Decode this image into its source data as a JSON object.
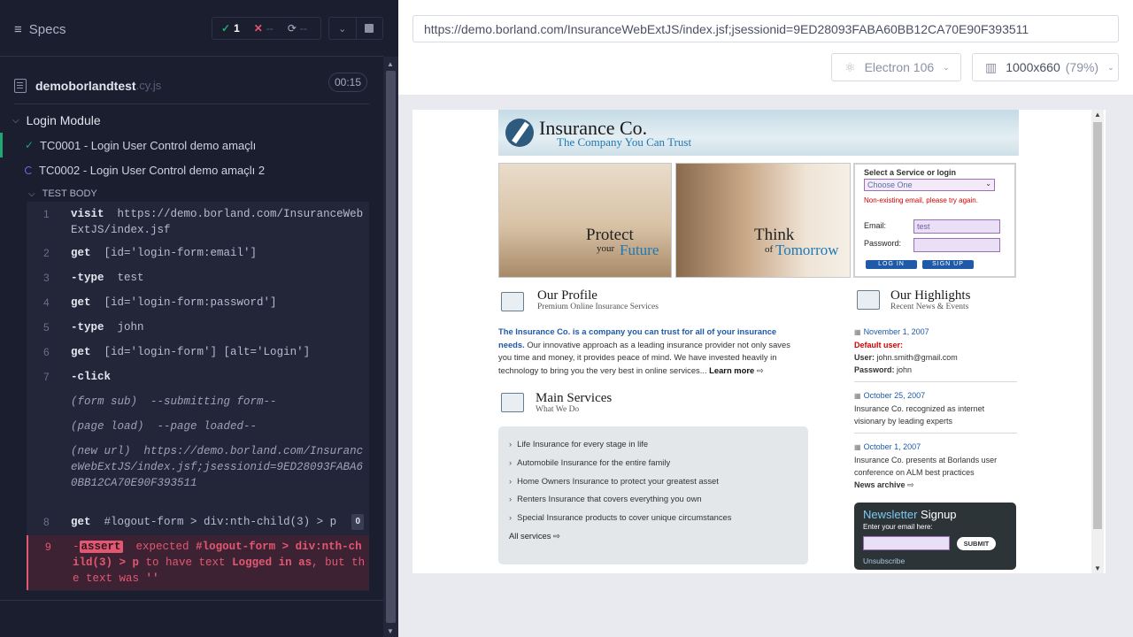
{
  "reporter": {
    "specs_label": "Specs",
    "passed": "1",
    "failed": "--",
    "pending": "--",
    "spec_name": "demoborlandtest",
    "spec_ext": ".cy.js",
    "duration": "00:15",
    "suite_title": "Login Module",
    "tests": [
      {
        "title": "TC0001 - Login User Control demo amaçlı",
        "state": "passed"
      },
      {
        "title": "TC0002 - Login User Control demo amaçlı 2",
        "state": "running"
      }
    ],
    "test_body_label": "TEST BODY",
    "commands": [
      {
        "num": "1",
        "name": "visit",
        "msg": "https://demo.borland.com/InsuranceWebExtJS/index.jsf"
      },
      {
        "num": "2",
        "name": "get",
        "msg": "[id='login-form:email']"
      },
      {
        "num": "3",
        "name": "-type",
        "msg": "test"
      },
      {
        "num": "4",
        "name": "get",
        "msg": "[id='login-form:password']"
      },
      {
        "num": "5",
        "name": "-type",
        "msg": "john"
      },
      {
        "num": "6",
        "name": "get",
        "msg": "[id='login-form'] [alt='Login']"
      },
      {
        "num": "7",
        "name": "-click",
        "msg": ""
      },
      {
        "num": "",
        "name": "(form sub)",
        "msg": "--submitting form--"
      },
      {
        "num": "",
        "name": "(page load)",
        "msg": "--page loaded--"
      },
      {
        "num": "",
        "name": "(new url)",
        "msg": "https://demo.borland.com/InsuranceWebExtJS/index.jsf;jsessionid=9ED28093FABA60BB12CA70E90F393511"
      },
      {
        "num": "8",
        "name": "get",
        "msg": "#logout-form > div:nth-child(3) > p",
        "badge": "0"
      },
      {
        "num": "9",
        "name": "assert",
        "msg_pre": "expected",
        "selector": "#logout-form > div:nth-child(3) > p",
        "msg_mid": "to have text",
        "expected_text": "Logged in as",
        "msg_end": ", but the text was",
        "actual": "''"
      }
    ]
  },
  "runner": {
    "url": "https://demo.borland.com/InsuranceWebExtJS/index.jsf;jsessionid=9ED28093FABA60BB12CA70E90F393511",
    "browser": "Electron 106",
    "viewport": "1000x660",
    "scale": "(79%)"
  },
  "site": {
    "logo_name": "Insurance Co.",
    "logo_tag": "The Company You Can Trust",
    "photo1": {
      "big": "Protect",
      "small": "your",
      "accent": "Future"
    },
    "photo2": {
      "big": "Think",
      "small": "of",
      "accent": "Tomorrow"
    },
    "login": {
      "title": "Select a Service or login",
      "select_value": "Choose One",
      "error": "Non-existing email, please try again.",
      "email_label": "Email:",
      "email_value": "test",
      "password_label": "Password:",
      "login_btn": "LOG IN",
      "signup_btn": "SIGN UP"
    },
    "profile": {
      "title": "Our Profile",
      "subtitle": "Premium Online Insurance Services",
      "lead": "The Insurance Co. is a company you can trust for all of your insurance needs.",
      "body": "Our innovative approach as a leading insurance provider not only saves you time and money, it provides peace of mind. We have invested heavily in technology to bring you the very best in online services...",
      "learn_more": "Learn more"
    },
    "services": {
      "title": "Main Services",
      "subtitle": "What We Do",
      "items": [
        "Life Insurance for every stage in life",
        "Automobile Insurance for the entire family",
        "Home Owners Insurance to protect your greatest asset",
        "Renters Insurance that covers everything you own",
        "Special Insurance products to cover unique circumstances"
      ],
      "all": "All services"
    },
    "highlights": {
      "title": "Our Highlights",
      "subtitle": "Recent News & Events",
      "items": [
        {
          "date": "November 1, 2007",
          "l1": "Default user:",
          "l2k": "User:",
          "l2v": "john.smith@gmail.com",
          "l3k": "Password:",
          "l3v": "john"
        },
        {
          "date": "October 25, 2007",
          "text": "Insurance Co. recognized as internet visionary by leading experts"
        },
        {
          "date": "October 1, 2007",
          "text": "Insurance Co. presents at Borlands user conference on ALM best practices",
          "more": "News archive"
        }
      ]
    },
    "newsletter": {
      "title_a": "Newsletter",
      "title_b": "Signup",
      "sub": "Enter your email here:",
      "submit": "SUBMIT",
      "unsubscribe": "Unsubscribe"
    }
  }
}
